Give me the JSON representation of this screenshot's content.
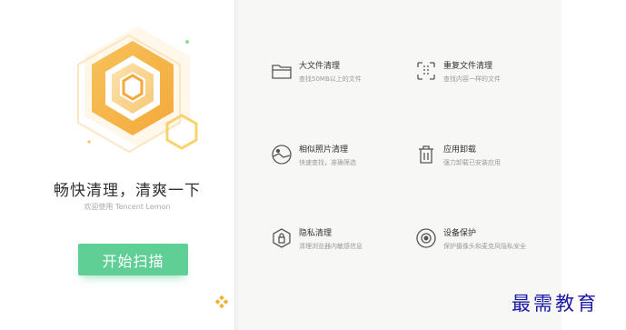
{
  "main": {
    "headline": "畅快清理，清爽一下",
    "subline": "欢迎使用 Tencent Lemon",
    "scan_button": "开始扫描"
  },
  "tools": [
    {
      "icon": "folder-icon",
      "title": "大文件清理",
      "desc": "查找50MB以上的文件"
    },
    {
      "icon": "duplicate-icon",
      "title": "重复文件清理",
      "desc": "查找内容一样的文件"
    },
    {
      "icon": "photo-icon",
      "title": "相似照片清理",
      "desc": "快速查找，准确筛选"
    },
    {
      "icon": "trash-icon",
      "title": "应用卸载",
      "desc": "强力卸载已安装应用"
    },
    {
      "icon": "shield-icon",
      "title": "隐私清理",
      "desc": "清理浏览器内敏感信息"
    },
    {
      "icon": "camera-icon",
      "title": "设备保护",
      "desc": "保护摄像头和麦克风隐私安全"
    }
  ],
  "watermark": "最需教育",
  "colors": {
    "accent_green": "#5fcf95",
    "logo_orange": "#f3b34a",
    "logo_yellow": "#f7d36b",
    "panel_bg": "#f7f7f6",
    "watermark_blue": "#1a1aa6"
  }
}
